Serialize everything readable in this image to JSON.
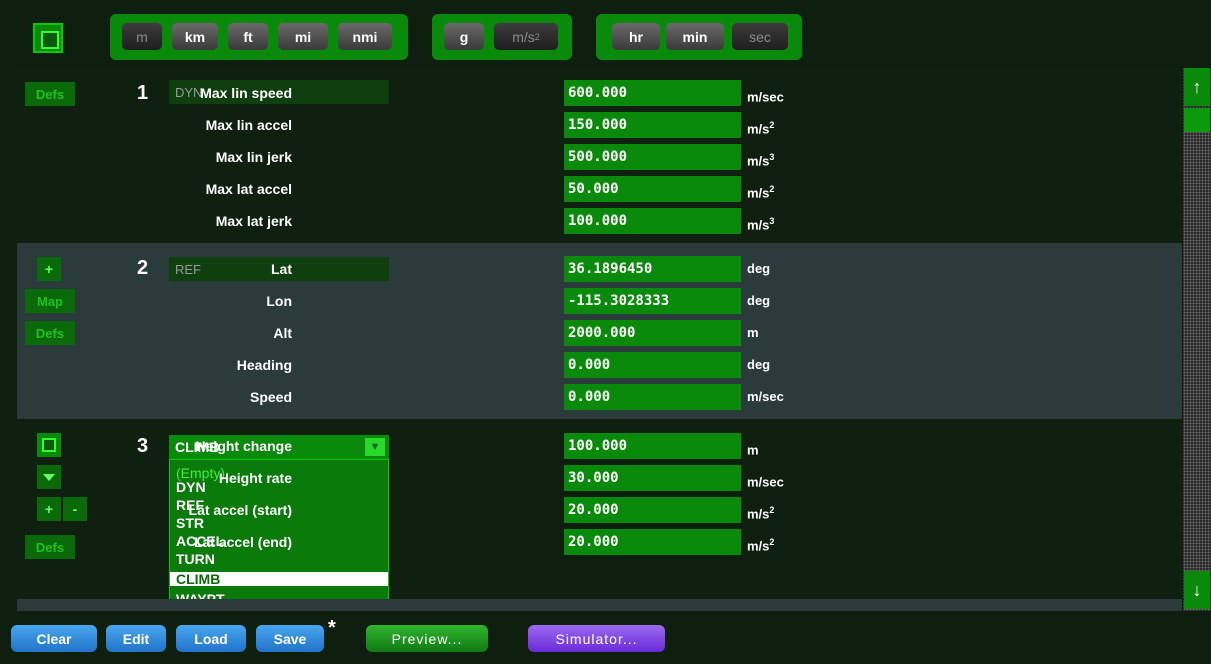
{
  "toolbar": {
    "distance_units": [
      "m",
      "km",
      "ft",
      "mi",
      "nmi"
    ],
    "distance_selected": "m",
    "accel_units": [
      "g",
      "m/s"
    ],
    "accel_selected": "m/s",
    "accel_exp": "2",
    "time_units": [
      "hr",
      "min",
      "sec"
    ],
    "time_selected": "sec"
  },
  "rows": [
    {
      "num": "1",
      "name": "DYN",
      "buttons": [
        "Defs"
      ],
      "params": [
        {
          "label": "Max lin speed",
          "value": "600.000",
          "unit": "m/sec",
          "exp": ""
        },
        {
          "label": "Max lin accel",
          "value": "150.000",
          "unit": "m/s",
          "exp": "2"
        },
        {
          "label": "Max lin jerk",
          "value": "500.000",
          "unit": "m/s",
          "exp": "3"
        },
        {
          "label": "Max lat accel",
          "value": "50.000",
          "unit": "m/s",
          "exp": "2"
        },
        {
          "label": "Max lat jerk",
          "value": "100.000",
          "unit": "m/s",
          "exp": "3"
        }
      ]
    },
    {
      "num": "2",
      "name": "REF",
      "buttons": [
        "+",
        "Map",
        "Defs"
      ],
      "params": [
        {
          "label": "Lat",
          "value": "36.1896450",
          "unit": "deg",
          "exp": ""
        },
        {
          "label": "Lon",
          "value": "-115.3028333",
          "unit": "deg",
          "exp": ""
        },
        {
          "label": "Alt",
          "value": "2000.000",
          "unit": "m",
          "exp": ""
        },
        {
          "label": "Heading",
          "value": "0.000",
          "unit": "deg",
          "exp": ""
        },
        {
          "label": "Speed",
          "value": "0.000",
          "unit": "m/sec",
          "exp": ""
        }
      ]
    },
    {
      "num": "3",
      "name": "CLIMB",
      "buttons": [
        "+",
        "-",
        "Defs"
      ],
      "params": [
        {
          "label": "Height change",
          "value": "100.000",
          "unit": "m",
          "exp": ""
        },
        {
          "label": "Height rate",
          "value": "30.000",
          "unit": "m/sec",
          "exp": ""
        },
        {
          "label": "Lat accel (start)",
          "value": "20.000",
          "unit": "m/s",
          "exp": "2"
        },
        {
          "label": "Lat accel (end)",
          "value": "20.000",
          "unit": "m/s",
          "exp": "2"
        }
      ],
      "dropdown_options": [
        "(Empty)",
        "DYN",
        "REF",
        "STR",
        "ACCEL",
        "TURN",
        "CLIMB",
        "WAYPT"
      ],
      "dropdown_selected": "CLIMB"
    }
  ],
  "bottom": {
    "clear": "Clear",
    "edit": "Edit",
    "load": "Load",
    "save": "Save",
    "unsaved_marker": "*",
    "preview": "Preview...",
    "simulator": "Simulator..."
  },
  "colors": {
    "background": "#0f1f0f",
    "field_green": "#0a8a0a",
    "row_alt": "#2b3b3b",
    "button_blue": "#2f8ee0",
    "button_purple": "#7f4ae8"
  }
}
